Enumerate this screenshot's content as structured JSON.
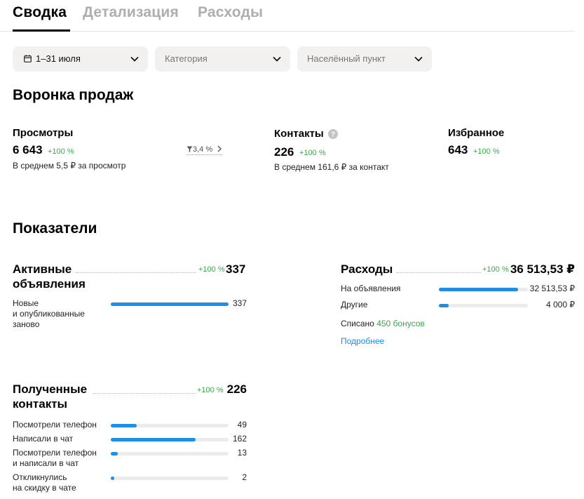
{
  "tabs": [
    {
      "label": "Сводка",
      "active": true
    },
    {
      "label": "Детализация",
      "active": false
    },
    {
      "label": "Расходы",
      "active": false
    }
  ],
  "filters": {
    "period": "1–31 июля",
    "category_placeholder": "Категория",
    "location_placeholder": "Населённый пункт"
  },
  "funnel": {
    "title": "Воронка продаж",
    "views": {
      "label": "Просмотры",
      "value": "6 643",
      "change": "+100 %",
      "avg": "В среднем 5,5 ₽ за просмотр"
    },
    "conversion": {
      "value": "3,4 %"
    },
    "contacts": {
      "label": "Контакты",
      "value": "226",
      "change": "+100 %",
      "avg": "В среднем 161,6 ₽ за контакт"
    },
    "favorites": {
      "label": "Избранное",
      "value": "643",
      "change": "+100 %"
    }
  },
  "indicators": {
    "title": "Показатели",
    "active_ads": {
      "title_line1": "Активные",
      "title_line2": "объявления",
      "change": "+100 %",
      "total": "337",
      "rows": [
        {
          "label_line1": "Новые",
          "label_line2": "и опубликованные",
          "label_line3": "заново",
          "value": "337",
          "fraction": 1.0
        }
      ]
    },
    "expenses": {
      "title": "Расходы",
      "change": "+100 %",
      "total": "36 513,53 ₽",
      "rows": [
        {
          "label": "На объявления",
          "value": "32 513,53 ₽",
          "fraction": 0.89
        },
        {
          "label": "Другие",
          "value": "4 000 ₽",
          "fraction": 0.11
        }
      ],
      "bonus_prefix": "Списано",
      "bonus_value": "450 бонусов",
      "more_link": "Подробнее"
    },
    "contacts": {
      "title_line1": "Полученные",
      "title_line2": "контакты",
      "change": "+100 %",
      "total": "226",
      "rows": [
        {
          "label_line1": "Посмотрели телефон",
          "label_line2": "",
          "value": "49",
          "fraction": 0.22
        },
        {
          "label_line1": "Написали в чат",
          "label_line2": "",
          "value": "162",
          "fraction": 0.72
        },
        {
          "label_line1": "Посмотрели телефон",
          "label_line2": "и написали в чат",
          "value": "13",
          "fraction": 0.06
        },
        {
          "label_line1": "Откликнулись",
          "label_line2": "на скидку в чате",
          "value": "2",
          "fraction": 0.02
        }
      ]
    }
  },
  "colors": {
    "accent": "#1f8ee6",
    "positive": "#3fa34d",
    "filter_bg": "#f2f1f0"
  }
}
